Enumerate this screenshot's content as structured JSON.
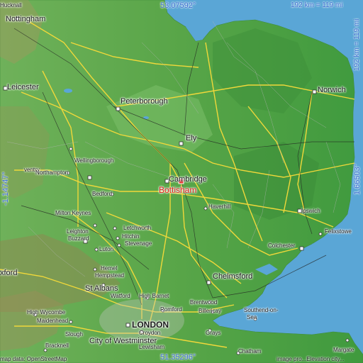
{
  "map": {
    "coords": {
      "top_lat": "53.07592°",
      "bottom_lat": "51.35296°",
      "left_lon": "-1.14747°",
      "right_lon": "1.66503°"
    },
    "scale": {
      "horizontal": "192 km = 119 mi",
      "vertical": "192 km = 119 mi"
    },
    "marker": {
      "label": "Bottisham",
      "color": "#e0201c"
    },
    "places": {
      "nottingham": "Nottingham",
      "hucknall": "Hucknall",
      "leicester": "Leicester",
      "peterborough": "Peterborough",
      "norwich": "Norwich",
      "ely": "Ely",
      "cambridge": "Cambridge",
      "wellingborough": "Wellingborough",
      "daventry": "ventry",
      "northampton": "Northampton",
      "bedford": "Bedford",
      "haverhill": "Haverhill",
      "ipswich": "Ipswich",
      "felixstowe": "Felixstowe",
      "milton_keynes": "Milton Keynes",
      "leighton": "Leighton",
      "buzzard": "Buzzard",
      "letchworth": "Letchworth",
      "hitchin": "Hitchin",
      "stevenage": "Stevenage",
      "luton": "Luton",
      "colchester": "Colchester",
      "oxford": "xford",
      "hemel": "Hemel",
      "hempstead": "Hempstead",
      "chelmsford": "Chelmsford",
      "st_albans": "St Albans",
      "watford": "Watford",
      "high_barnet": "High Barnet",
      "brentwood": "Brentwood",
      "high_wycombe": "High Wycombe",
      "romford": "Romford",
      "billericay": "Billericay",
      "southend": "Southend-on-",
      "southend2": "Sea",
      "maidenhead": "Maidenhead",
      "london": "LONDON",
      "croydon": "Croydon",
      "slough": "Slough",
      "bracknell": "Bracknell",
      "westminster": "City of Westminster",
      "lewisham": "Lewisham",
      "grays": "Grays",
      "chatham": "Chatham",
      "margate": "Margate"
    },
    "attribution_left": "map data: OpenStreetMap",
    "attribution_right": "image pro...Elevation city..."
  }
}
